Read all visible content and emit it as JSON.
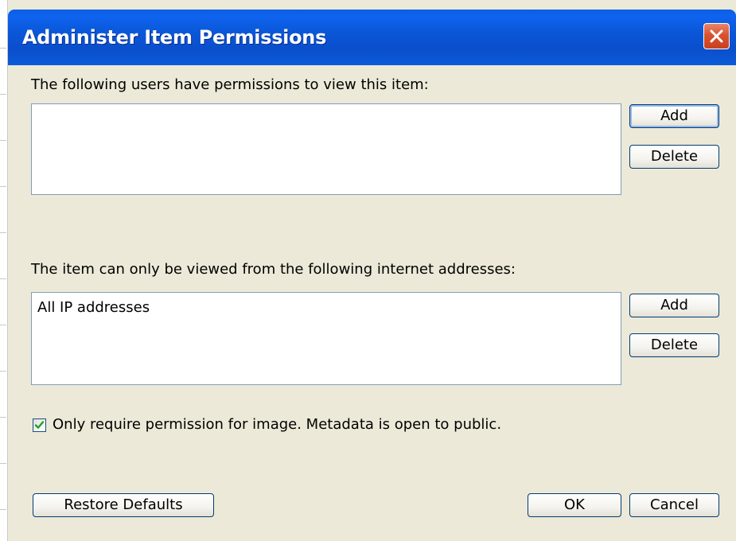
{
  "window": {
    "title": "Administer Item Permissions"
  },
  "users_section": {
    "label": "The following users have permissions to view this item:",
    "items": [],
    "add_label": "Add",
    "delete_label": "Delete"
  },
  "ip_section": {
    "label": "The item can only be viewed from the following internet addresses:",
    "items": [
      "All IP addresses"
    ],
    "add_label": "Add",
    "delete_label": "Delete"
  },
  "metadata_option": {
    "label": "Only require permission for image. Metadata is open to public.",
    "checked": true
  },
  "footer": {
    "restore_label": "Restore Defaults",
    "ok_label": "OK",
    "cancel_label": "Cancel"
  },
  "colors": {
    "titlebar": "#0a56d6",
    "close_button": "#d9532f",
    "dialog_background": "#ece9d8",
    "checkmark": "#21a121"
  },
  "icons": {
    "close": "close-icon",
    "check": "checkmark-icon"
  }
}
